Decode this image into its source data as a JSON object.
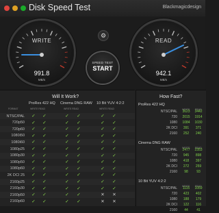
{
  "window": {
    "title": "Disk Speed Test",
    "brand": "Blackmagicdesign"
  },
  "gauges": {
    "write": {
      "label": "WRITE",
      "value": "991.8",
      "unit": "MB/s"
    },
    "read": {
      "label": "READ",
      "value": "942.1",
      "unit": "MB/s"
    }
  },
  "start_button": {
    "top": "SPEED TEST",
    "label": "START"
  },
  "will_it_work": {
    "title": "Will It Work?",
    "format_label": "FORMAT",
    "columns": [
      {
        "name": "ProRes 422 HQ"
      },
      {
        "name": "Cinema DNG RAW"
      },
      {
        "name": "10 Bit YUV 4:2:2"
      }
    ],
    "sub_label": "WRITE  READ",
    "rows": [
      {
        "label": "NTSC/PAL",
        "marks": [
          "ok",
          "ok",
          "ok",
          "ok",
          "ok",
          "ok"
        ]
      },
      {
        "label": "720p50",
        "marks": [
          "ok",
          "ok",
          "ok",
          "ok",
          "ok",
          "ok"
        ]
      },
      {
        "label": "720p60",
        "marks": [
          "ok",
          "ok",
          "ok",
          "ok",
          "ok",
          "ok"
        ]
      },
      {
        "label": "1080i50",
        "marks": [
          "ok",
          "ok",
          "ok",
          "ok",
          "ok",
          "ok"
        ]
      },
      {
        "label": "1080i60",
        "marks": [
          "ok",
          "ok",
          "ok",
          "ok",
          "ok",
          "ok"
        ]
      },
      {
        "label": "1080p25",
        "marks": [
          "ok",
          "ok",
          "ok",
          "ok",
          "ok",
          "ok"
        ]
      },
      {
        "label": "1080p30",
        "marks": [
          "ok",
          "ok",
          "ok",
          "ok",
          "ok",
          "ok"
        ]
      },
      {
        "label": "1080p50",
        "marks": [
          "ok",
          "ok",
          "ok",
          "ok",
          "ok",
          "ok"
        ]
      },
      {
        "label": "1080p60",
        "marks": [
          "ok",
          "ok",
          "ok",
          "ok",
          "ok",
          "ok"
        ]
      },
      {
        "label": "2K DCI 25",
        "marks": [
          "ok",
          "ok",
          "ok",
          "ok",
          "ok",
          "ok"
        ]
      },
      {
        "label": "2160p25",
        "marks": [
          "ok",
          "ok",
          "ok",
          "ok",
          "ok",
          "ok"
        ]
      },
      {
        "label": "2160p30",
        "marks": [
          "ok",
          "ok",
          "ok",
          "ok",
          "ok",
          "ok"
        ]
      },
      {
        "label": "2160p50",
        "marks": [
          "ok",
          "ok",
          "ok",
          "ok",
          "no",
          "no"
        ]
      },
      {
        "label": "2160p60",
        "marks": [
          "ok",
          "ok",
          "ok",
          "ok",
          "no",
          "no"
        ]
      }
    ]
  },
  "how_fast": {
    "title": "How Fast?",
    "groups": [
      {
        "name": "ProRes 422 HQ",
        "rows": [
          {
            "label": "NTSC/PAL",
            "write": "3623",
            "read": "3442"
          },
          {
            "label": "720",
            "write": "2015",
            "read": "1914"
          },
          {
            "label": "1080",
            "write": "1084",
            "read": "1030"
          },
          {
            "label": "2K DCI",
            "write": "391",
            "read": "371"
          },
          {
            "label": "2160",
            "write": "252",
            "read": "240"
          }
        ]
      },
      {
        "name": "Cinema DNG RAW",
        "rows": [
          {
            "label": "NTSC/PAL",
            "write": "2477",
            "read": "2353"
          },
          {
            "label": "720",
            "write": "945",
            "read": "898"
          },
          {
            "label": "1080",
            "write": "418",
            "read": "397"
          },
          {
            "label": "2K DCI",
            "write": "272",
            "read": "259"
          },
          {
            "label": "2160",
            "write": "98",
            "read": "93"
          }
        ]
      },
      {
        "name": "10 Bit YUV 4:2:2",
        "rows": [
          {
            "label": "NTSC/PAL",
            "write": "1115",
            "read": "1059"
          },
          {
            "label": "720",
            "write": "423",
            "read": "402"
          },
          {
            "label": "1080",
            "write": "188",
            "read": "179"
          },
          {
            "label": "2K DCI",
            "write": "122",
            "read": "116"
          },
          {
            "label": "2160",
            "write": "44",
            "read": "41"
          }
        ]
      }
    ],
    "write_label": "WRITE",
    "read_label": "READ"
  },
  "colors": {
    "ok": "#8fe04f",
    "needle": "#3a8fe0",
    "redzone": "#c0392b"
  }
}
